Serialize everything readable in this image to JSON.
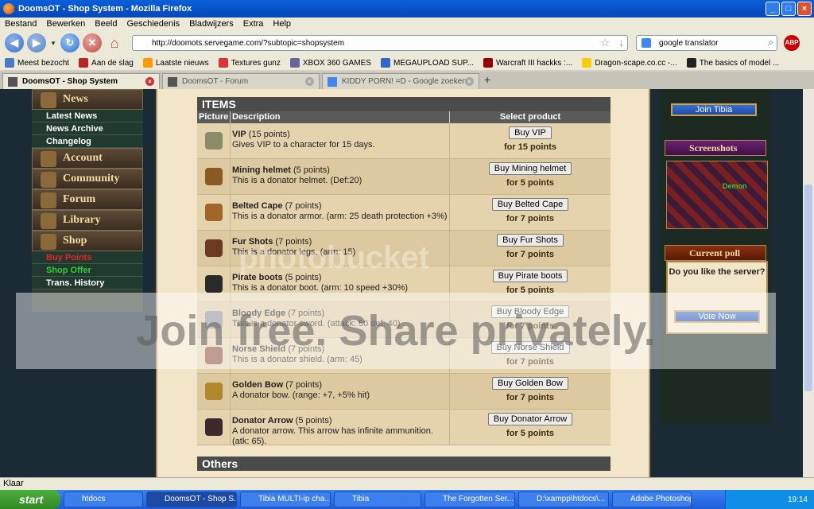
{
  "window": {
    "title": "DoomsOT - Shop System - Mozilla Firefox"
  },
  "menu": [
    "Bestand",
    "Bewerken",
    "Beeld",
    "Geschiedenis",
    "Bladwijzers",
    "Extra",
    "Help"
  ],
  "address": {
    "url": "http://doomots.servegame.com/?subtopic=shopsystem"
  },
  "search": {
    "value": "google translator"
  },
  "bookmarks": [
    "Meest bezocht",
    "Aan de slag",
    "Laatste nieuws",
    "Textures gunz",
    "XBOX 360 GAMES",
    "MEGAUPLOAD SUP...",
    "Warcraft III hackks :...",
    "Dragon-scape.co.cc -...",
    "The basics of model ..."
  ],
  "tabs": [
    "DoomsOT - Shop System",
    "DoomsOT - Forum",
    "KIDDY PORN! =D - Google zoeken"
  ],
  "sidebar": {
    "news": "News",
    "news_items": [
      "Latest News",
      "News Archive",
      "Changelog"
    ],
    "sections": [
      "Account",
      "Community",
      "Forum",
      "Library",
      "Shop"
    ],
    "shop_items": [
      "Buy Points",
      "Shop Offer",
      "Trans. History"
    ]
  },
  "items_box": {
    "title": "ITEMS",
    "col_picture": "Picture",
    "col_description": "Description",
    "col_select": "Select product",
    "rows": [
      {
        "name": "VIP",
        "points_label": "(15 points)",
        "desc": "Gives VIP to a character for 15 days.",
        "button": "Buy VIP",
        "for": "for 15 points"
      },
      {
        "name": "Mining helmet",
        "points_label": "(5 points)",
        "desc": "This is a donator helmet. (Def:20)",
        "button": "Buy Mining helmet",
        "for": "for 5 points"
      },
      {
        "name": "Belted Cape",
        "points_label": "(7 points)",
        "desc": "This is a donator armor. (arm: 25 death protection +3%)",
        "button": "Buy Belted Cape",
        "for": "for 7 points"
      },
      {
        "name": "Fur Shots",
        "points_label": "(7 points)",
        "desc": "This is a donator legs. (arm: 15)",
        "button": "Buy Fur Shots",
        "for": "for 7 points"
      },
      {
        "name": "Pirate boots",
        "points_label": "(5 points)",
        "desc": "This is a donator boot. (arm: 10 speed +30%)",
        "button": "Buy Pirate boots",
        "for": "for 5 points"
      },
      {
        "name": "Bloody Edge",
        "points_label": "(7 points)",
        "desc": "This is a donator sword. (attack: 50 def: 40)",
        "button": "Buy Bloody Edge",
        "for": "for 7 points"
      },
      {
        "name": "Norse Shield",
        "points_label": "(7 points)",
        "desc": "This is a donator shield. (arm: 45)",
        "button": "Buy Norse Shield",
        "for": "for 7 points"
      },
      {
        "name": "Golden Bow",
        "points_label": "(7 points)",
        "desc": "A donator bow. (range: +7, +5% hit)",
        "button": "Buy Golden Bow",
        "for": "for 7 points"
      },
      {
        "name": "Donator Arrow",
        "points_label": "(5 points)",
        "desc": "A donator arrow. This arrow has infinite ammunition. (atk: 65).",
        "button": "Buy Donator Arrow",
        "for": "for 5 points"
      }
    ]
  },
  "others_box": {
    "title": "Others"
  },
  "right": {
    "join": "Join Tibia",
    "screenshots": "Screenshots",
    "shot_label": "Demon",
    "poll": "Current poll",
    "poll_question": "Do you like the server?",
    "vote": "Vote Now"
  },
  "watermark": {
    "main": "Join free. Share privately.",
    "brand": "photobucket"
  },
  "status": {
    "text": "Klaar"
  },
  "taskbar": {
    "start": "start",
    "tasks": [
      "htdocs",
      "DoomsOT - Shop S...",
      "Tibia MULTI-ip cha...",
      "Tibia",
      "The Forgotten Ser...",
      "D:\\xampp\\htdocs\\...",
      "Adobe Photoshop ..."
    ],
    "clock": "19:14"
  }
}
